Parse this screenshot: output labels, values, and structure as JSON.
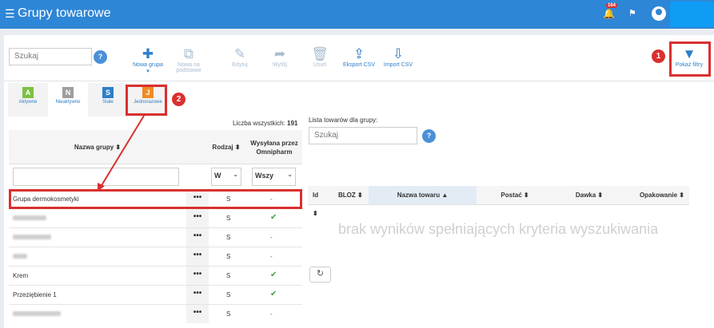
{
  "header": {
    "menu_icon": "☰",
    "title": "Grupy towarowe",
    "bell_icon": "🔔",
    "notif_count": "164",
    "flag_icon": "⚑"
  },
  "toolbar": {
    "search_placeholder": "Szukaj",
    "help": "?",
    "buttons": [
      {
        "icon": "✚",
        "label": "Nowa grupa"
      },
      {
        "icon": "⧉",
        "label": "Nowa na podstawie"
      },
      {
        "icon": "✎",
        "label": "Edytuj"
      },
      {
        "icon": "➦",
        "label": "Wyślij"
      },
      {
        "icon": "🗑",
        "label": "Usuń"
      },
      {
        "icon": "⇪",
        "label": "Eksport CSV"
      },
      {
        "icon": "⇩",
        "label": "Import CSV"
      }
    ],
    "new_group_caret": "▾",
    "filters_icon": "▼",
    "filters_label": "Pokaż filtry"
  },
  "annotations": {
    "n1": "1",
    "n2": "2"
  },
  "tabs": [
    {
      "letter": "A",
      "label": "Aktywne",
      "color": "#7cc143"
    },
    {
      "letter": "N",
      "label": "Nieaktywne",
      "color": "#9e9e9e"
    },
    {
      "letter": "S",
      "label": "Stałe",
      "color": "#2e7fc8"
    },
    {
      "letter": "J",
      "label": "Jednorazowe",
      "color": "#f08a24"
    }
  ],
  "left": {
    "count_label": "Liczba wszystkich:",
    "count_value": "191",
    "col_name": "Nazwa grupy ⬍",
    "col_kind": "Rodzaj ⬍",
    "col_sent": "Wysyłana przez Omnipharm",
    "kind_filter": "W",
    "sent_filter": "Wszy",
    "select_arrow": "⌄",
    "row_menu": "•••",
    "rows": [
      {
        "name": "Grupa dermokosmetyki",
        "kind": "S",
        "sent": "-"
      },
      {
        "name": "",
        "kind": "S",
        "sent": "✔"
      },
      {
        "name": "",
        "kind": "S",
        "sent": "-"
      },
      {
        "name": "",
        "kind": "S",
        "sent": "-"
      },
      {
        "name": "Krem",
        "kind": "S",
        "sent": "✔"
      },
      {
        "name": "Przeziębienie 1",
        "kind": "S",
        "sent": "✔"
      },
      {
        "name": "",
        "kind": "S",
        "sent": "-"
      }
    ]
  },
  "right": {
    "label": "Lista towarów dla grupy:",
    "search_placeholder": "Szukaj",
    "help": "?",
    "cols": [
      "Id ⬍",
      "BLOZ ⬍",
      "Nazwa towaru ▲",
      "Postać ⬍",
      "Dawka ⬍",
      "Opakowanie ⬍"
    ],
    "no_results": "brak wyników spełniających kryteria wyszukiwania",
    "refresh_icon": "↻"
  },
  "colors": {
    "topbar": "#2e86d6",
    "accent": "#2e7fc8",
    "annotation": "#d9302f"
  }
}
